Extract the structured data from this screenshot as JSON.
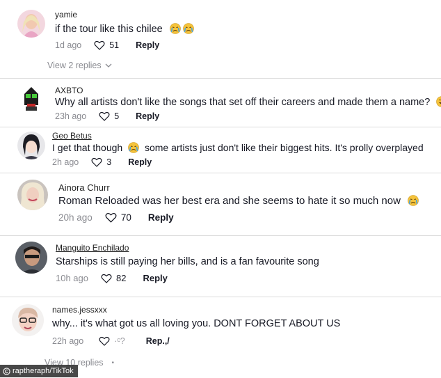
{
  "comments": [
    {
      "username": "yamie",
      "text": "if the tour like this chilee",
      "emoji": [
        "crying-face",
        "crying-face"
      ],
      "time": "1d ago",
      "likes": "51",
      "reply_label": "Reply",
      "view_replies": "View 2 replies"
    },
    {
      "username": "AXBTO",
      "text": "Why all artists don't like the songs that set off their careers and made them a name?",
      "emoji": [
        "grinning-sweat-face"
      ],
      "time": "23h ago",
      "likes": "5",
      "reply_label": "Reply"
    },
    {
      "username": "Geo Betus",
      "text_before": "I get that though",
      "text_after": "some artists just don't like their biggest hits. It's prolly overplayed",
      "emoji": [
        "crying-face"
      ],
      "time": "2h ago",
      "likes": "3",
      "reply_label": "Reply"
    },
    {
      "username": "Ainora Churr",
      "text": "Roman Reloaded was her best era and she seems to hate it so much now",
      "emoji": [
        "crying-face"
      ],
      "time": "20h ago",
      "likes": "70",
      "reply_label": "Reply"
    },
    {
      "username": "Manguito Enchilado",
      "text": "Starships is still paying her bills, and is a fan favourite song",
      "time": "10h ago",
      "likes": "82",
      "reply_label": "Reply"
    },
    {
      "username": "names.jessxxx",
      "text": "why... it's what got us all loving you. DONT FORGET ABOUT US",
      "time": "22h ago",
      "likes": "·ᶜ?",
      "reply_label": "Rep.,/",
      "view_replies": "View 10 replies"
    }
  ],
  "credit": "raptheraph/TikTok",
  "colors": {
    "text": "#161823",
    "meta": "#8a8b91",
    "emoji": "#f5c33b",
    "tear": "#4aa3df"
  }
}
